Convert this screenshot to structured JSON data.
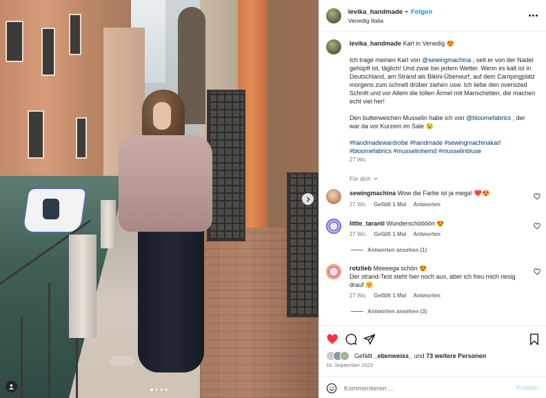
{
  "post": {
    "username": "levika_handmade",
    "follow_label": "Folgen",
    "separator": "•",
    "location": "Venedig Italia"
  },
  "caption": {
    "username": "levika_handmade",
    "title": "Karl in Venedig 😍",
    "p1_before": "Ich trage meinen Karl von ",
    "p1_mention": "@sewingmachina",
    "p1_after": " , seit er von der Nadel gehüpft ist, täglich! Und zwar bei jedem Wetter. Wenn es kalt ist in Deutschland, am Strand als Bikini-Überwurf, auf dem Campingplatz morgens zum schnell drüber ziehen usw. Ich liebe den oversized Schnitt und vor Allem die tollen Ärmel mit Manschetten, die machen echt viel her!",
    "p2_before": "Den butterweichen Musselin habe ich von ",
    "p2_mention": "@bloomefabrics",
    "p2_after": " , der war da vor Kurzem im Sale 😉",
    "hashtags": "#handmadewardrobe #handmade #sewingmachinakarl #bloomefabrics #musselinhemd #musselinbluse",
    "time": "27 Wo."
  },
  "see_translation": "Für dich",
  "comments": [
    {
      "user": "sewingmachina",
      "text": "Wow die Farbe ist ja mega! ❤️😍",
      "time": "27 Wo.",
      "likes": "Gefällt 1 Mal",
      "reply": "Antworten"
    },
    {
      "user": "little_taranti",
      "text": "Wunderschöööön 😍",
      "time": "27 Wo.",
      "likes": "Gefällt 1 Mal",
      "reply": "Antworten",
      "replies_label": "Antworten ansehen (1)"
    },
    {
      "user": "rotzlieb",
      "text": "Meeeega schön 😍",
      "text2": "Der strand-Test steht hier noch aus, aber ich freu mich riesig drauf 🤗",
      "time": "27 Wo.",
      "likes": "Gefällt 1 Mal",
      "reply": "Antworten",
      "replies_label": "Antworten ansehen (3)"
    }
  ],
  "likes": {
    "prefix": "Gefällt ",
    "user": "_ebenweiss_",
    "middle": " und ",
    "others": "73 weitere Personen"
  },
  "date": "15. September 2023",
  "comment_box": {
    "placeholder": "Kommentieren ...",
    "post_label": "Posten"
  },
  "colors": {
    "accent": "#0095f6",
    "like_red": "#ff3040",
    "mention": "#00376b",
    "muted": "#737373"
  },
  "icons": [
    "heart-icon",
    "comment-icon",
    "share-icon",
    "bookmark-icon",
    "more-icon",
    "emoji-icon",
    "chevron-right-icon",
    "chevron-down-icon",
    "user-tag-icon"
  ]
}
